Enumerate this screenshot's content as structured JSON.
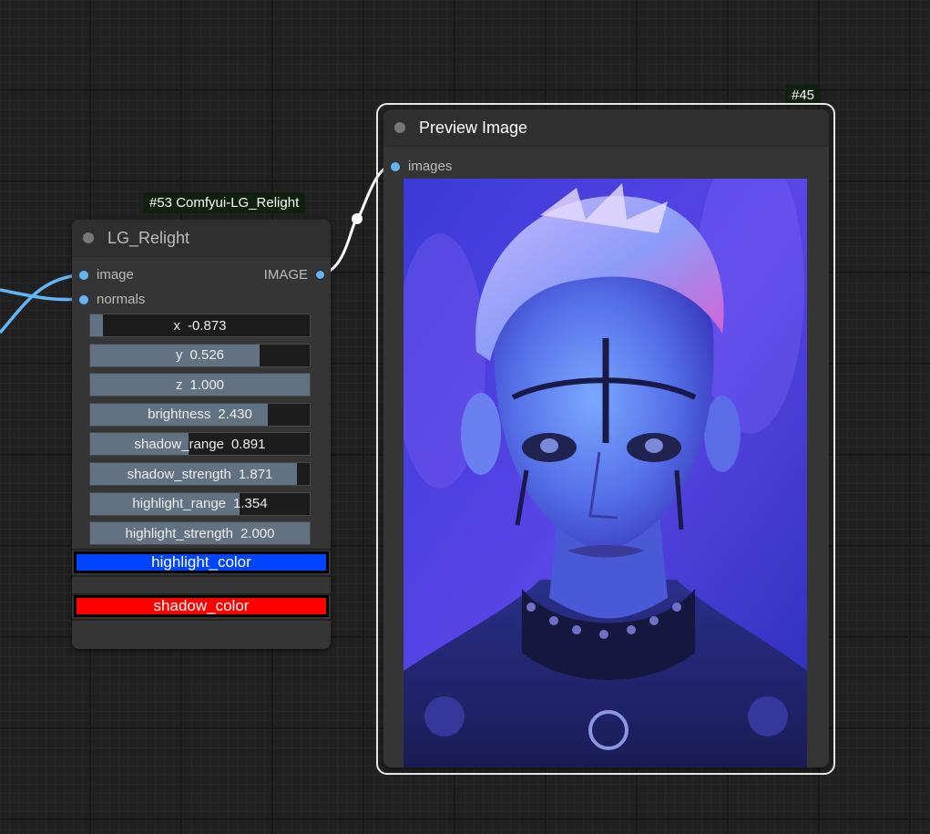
{
  "relight_node": {
    "badge": "#53 Comfyui-LG_Relight",
    "title": "LG_Relight",
    "inputs": [
      "image",
      "normals"
    ],
    "output": "IMAGE",
    "widgets": [
      {
        "label": "x",
        "value": "-0.873",
        "fill": 0.06
      },
      {
        "label": "y",
        "value": "0.526",
        "fill": 0.77
      },
      {
        "label": "z",
        "value": "1.000",
        "fill": 1.0
      },
      {
        "label": "brightness",
        "value": "2.430",
        "fill": 0.81
      },
      {
        "label": "shadow_range",
        "value": "0.891",
        "fill": 0.45
      },
      {
        "label": "shadow_strength",
        "value": "1.871",
        "fill": 0.94
      },
      {
        "label": "highlight_range",
        "value": "1.354",
        "fill": 0.68
      },
      {
        "label": "highlight_strength",
        "value": "2.000",
        "fill": 1.0
      }
    ],
    "highlight_color": {
      "label": "highlight_color",
      "color": "#0044ff"
    },
    "shadow_color": {
      "label": "shadow_color",
      "color": "#ff0000"
    }
  },
  "preview_node": {
    "badge": "#45",
    "title": "Preview Image",
    "input": "images"
  },
  "colors": {
    "slot": "#64b5f6",
    "wire_image": "#ffffff",
    "wire_normals": "#64b5f6",
    "badge_bg": "#10200f"
  }
}
